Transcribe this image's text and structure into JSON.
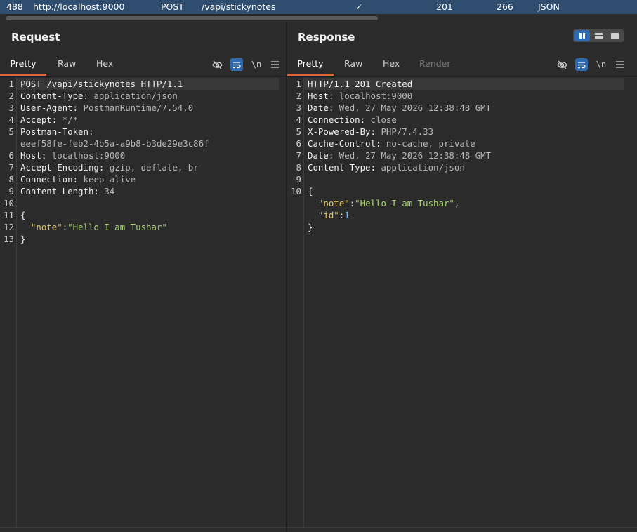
{
  "history_row": {
    "number": "488",
    "host": "http://localhost:9000",
    "method": "POST",
    "path": "/vapi/stickynotes",
    "check": "✓",
    "status": "201",
    "length": "266",
    "mime": "JSON"
  },
  "request": {
    "title": "Request",
    "tabs": [
      "Pretty",
      "Raw",
      "Hex"
    ],
    "tool_icons": [
      "eye-slash-icon",
      "wrap-icon",
      "newline-toggle",
      "menu-icon"
    ],
    "newline_label": "\\n",
    "lines": [
      {
        "n": "1",
        "key": "POST /vapi/stickynotes HTTP/1.1",
        "val": ""
      },
      {
        "n": "2",
        "key": "Content-Type:",
        "val": " application/json"
      },
      {
        "n": "3",
        "key": "User-Agent:",
        "val": " PostmanRuntime/7.54.0"
      },
      {
        "n": "4",
        "key": "Accept:",
        "val": " */*"
      },
      {
        "n": "5",
        "key": "Postman-Token:",
        "val": ""
      },
      {
        "n": "",
        "key": "",
        "val": "eeef58fe-feb2-4b5a-a9b8-b3de29e3c86f"
      },
      {
        "n": "6",
        "key": "Host:",
        "val": " localhost:9000"
      },
      {
        "n": "7",
        "key": "Accept-Encoding:",
        "val": " gzip, deflate, br"
      },
      {
        "n": "8",
        "key": "Connection:",
        "val": " keep-alive"
      },
      {
        "n": "9",
        "key": "Content-Length:",
        "val": " 34"
      },
      {
        "n": "10",
        "key": "",
        "val": ""
      },
      {
        "n": "11",
        "key": "{",
        "val": ""
      },
      {
        "n": "12",
        "json": [
          {
            "t": "  "
          },
          {
            "t": "\"note\"",
            "c": "jkey"
          },
          {
            "t": ":"
          },
          {
            "t": "\"Hello I am Tushar\"",
            "c": "jstr"
          }
        ]
      },
      {
        "n": "13",
        "key": "}",
        "val": ""
      }
    ]
  },
  "response": {
    "title": "Response",
    "tabs": [
      "Pretty",
      "Raw",
      "Hex",
      "Render"
    ],
    "tool_icons": [
      "eye-slash-icon",
      "wrap-icon",
      "newline-toggle",
      "menu-icon"
    ],
    "newline_label": "\\n",
    "lines": [
      {
        "n": "1",
        "key": "HTTP/1.1 201 Created",
        "val": ""
      },
      {
        "n": "2",
        "key": "Host:",
        "val": " localhost:9000"
      },
      {
        "n": "3",
        "key": "Date:",
        "val": " Wed, 27 May 2026 12:38:48 GMT"
      },
      {
        "n": "4",
        "key": "Connection:",
        "val": " close"
      },
      {
        "n": "5",
        "key": "X-Powered-By:",
        "val": " PHP/7.4.33"
      },
      {
        "n": "6",
        "key": "Cache-Control:",
        "val": " no-cache, private"
      },
      {
        "n": "7",
        "key": "Date:",
        "val": " Wed, 27 May 2026 12:38:48 GMT"
      },
      {
        "n": "8",
        "key": "Content-Type:",
        "val": " application/json"
      },
      {
        "n": "9",
        "key": "",
        "val": ""
      },
      {
        "n": "10",
        "key": "{",
        "val": ""
      },
      {
        "n": "",
        "json": [
          {
            "t": "  "
          },
          {
            "t": "\"note\"",
            "c": "jkey"
          },
          {
            "t": ":"
          },
          {
            "t": "\"Hello I am Tushar\"",
            "c": "jstr"
          },
          {
            "t": ","
          }
        ]
      },
      {
        "n": "",
        "json": [
          {
            "t": "  "
          },
          {
            "t": "\"id\"",
            "c": "jkey"
          },
          {
            "t": ":"
          },
          {
            "t": "1",
            "c": "jnum"
          }
        ]
      },
      {
        "n": "",
        "key": "}",
        "val": ""
      }
    ]
  },
  "colors": {
    "accent_tab": "#e0653b",
    "selected_row": "#2f4d6e",
    "toggle_on": "#2d6ab0"
  }
}
